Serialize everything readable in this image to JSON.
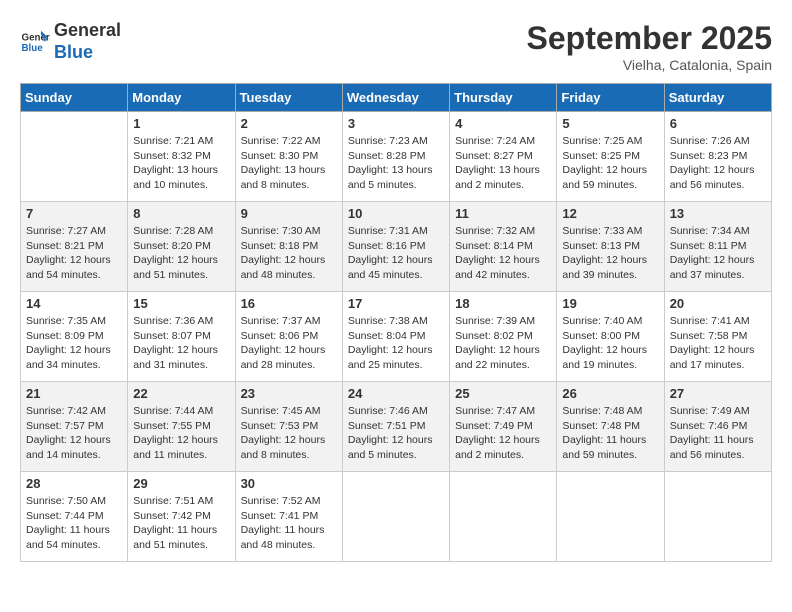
{
  "header": {
    "logo_general": "General",
    "logo_blue": "Blue",
    "month_title": "September 2025",
    "location": "Vielha, Catalonia, Spain"
  },
  "days_of_week": [
    "Sunday",
    "Monday",
    "Tuesday",
    "Wednesday",
    "Thursday",
    "Friday",
    "Saturday"
  ],
  "weeks": [
    [
      {
        "day": "",
        "info": ""
      },
      {
        "day": "1",
        "info": "Sunrise: 7:21 AM\nSunset: 8:32 PM\nDaylight: 13 hours\nand 10 minutes."
      },
      {
        "day": "2",
        "info": "Sunrise: 7:22 AM\nSunset: 8:30 PM\nDaylight: 13 hours\nand 8 minutes."
      },
      {
        "day": "3",
        "info": "Sunrise: 7:23 AM\nSunset: 8:28 PM\nDaylight: 13 hours\nand 5 minutes."
      },
      {
        "day": "4",
        "info": "Sunrise: 7:24 AM\nSunset: 8:27 PM\nDaylight: 13 hours\nand 2 minutes."
      },
      {
        "day": "5",
        "info": "Sunrise: 7:25 AM\nSunset: 8:25 PM\nDaylight: 12 hours\nand 59 minutes."
      },
      {
        "day": "6",
        "info": "Sunrise: 7:26 AM\nSunset: 8:23 PM\nDaylight: 12 hours\nand 56 minutes."
      }
    ],
    [
      {
        "day": "7",
        "info": "Sunrise: 7:27 AM\nSunset: 8:21 PM\nDaylight: 12 hours\nand 54 minutes."
      },
      {
        "day": "8",
        "info": "Sunrise: 7:28 AM\nSunset: 8:20 PM\nDaylight: 12 hours\nand 51 minutes."
      },
      {
        "day": "9",
        "info": "Sunrise: 7:30 AM\nSunset: 8:18 PM\nDaylight: 12 hours\nand 48 minutes."
      },
      {
        "day": "10",
        "info": "Sunrise: 7:31 AM\nSunset: 8:16 PM\nDaylight: 12 hours\nand 45 minutes."
      },
      {
        "day": "11",
        "info": "Sunrise: 7:32 AM\nSunset: 8:14 PM\nDaylight: 12 hours\nand 42 minutes."
      },
      {
        "day": "12",
        "info": "Sunrise: 7:33 AM\nSunset: 8:13 PM\nDaylight: 12 hours\nand 39 minutes."
      },
      {
        "day": "13",
        "info": "Sunrise: 7:34 AM\nSunset: 8:11 PM\nDaylight: 12 hours\nand 37 minutes."
      }
    ],
    [
      {
        "day": "14",
        "info": "Sunrise: 7:35 AM\nSunset: 8:09 PM\nDaylight: 12 hours\nand 34 minutes."
      },
      {
        "day": "15",
        "info": "Sunrise: 7:36 AM\nSunset: 8:07 PM\nDaylight: 12 hours\nand 31 minutes."
      },
      {
        "day": "16",
        "info": "Sunrise: 7:37 AM\nSunset: 8:06 PM\nDaylight: 12 hours\nand 28 minutes."
      },
      {
        "day": "17",
        "info": "Sunrise: 7:38 AM\nSunset: 8:04 PM\nDaylight: 12 hours\nand 25 minutes."
      },
      {
        "day": "18",
        "info": "Sunrise: 7:39 AM\nSunset: 8:02 PM\nDaylight: 12 hours\nand 22 minutes."
      },
      {
        "day": "19",
        "info": "Sunrise: 7:40 AM\nSunset: 8:00 PM\nDaylight: 12 hours\nand 19 minutes."
      },
      {
        "day": "20",
        "info": "Sunrise: 7:41 AM\nSunset: 7:58 PM\nDaylight: 12 hours\nand 17 minutes."
      }
    ],
    [
      {
        "day": "21",
        "info": "Sunrise: 7:42 AM\nSunset: 7:57 PM\nDaylight: 12 hours\nand 14 minutes."
      },
      {
        "day": "22",
        "info": "Sunrise: 7:44 AM\nSunset: 7:55 PM\nDaylight: 12 hours\nand 11 minutes."
      },
      {
        "day": "23",
        "info": "Sunrise: 7:45 AM\nSunset: 7:53 PM\nDaylight: 12 hours\nand 8 minutes."
      },
      {
        "day": "24",
        "info": "Sunrise: 7:46 AM\nSunset: 7:51 PM\nDaylight: 12 hours\nand 5 minutes."
      },
      {
        "day": "25",
        "info": "Sunrise: 7:47 AM\nSunset: 7:49 PM\nDaylight: 12 hours\nand 2 minutes."
      },
      {
        "day": "26",
        "info": "Sunrise: 7:48 AM\nSunset: 7:48 PM\nDaylight: 11 hours\nand 59 minutes."
      },
      {
        "day": "27",
        "info": "Sunrise: 7:49 AM\nSunset: 7:46 PM\nDaylight: 11 hours\nand 56 minutes."
      }
    ],
    [
      {
        "day": "28",
        "info": "Sunrise: 7:50 AM\nSunset: 7:44 PM\nDaylight: 11 hours\nand 54 minutes."
      },
      {
        "day": "29",
        "info": "Sunrise: 7:51 AM\nSunset: 7:42 PM\nDaylight: 11 hours\nand 51 minutes."
      },
      {
        "day": "30",
        "info": "Sunrise: 7:52 AM\nSunset: 7:41 PM\nDaylight: 11 hours\nand 48 minutes."
      },
      {
        "day": "",
        "info": ""
      },
      {
        "day": "",
        "info": ""
      },
      {
        "day": "",
        "info": ""
      },
      {
        "day": "",
        "info": ""
      }
    ]
  ]
}
